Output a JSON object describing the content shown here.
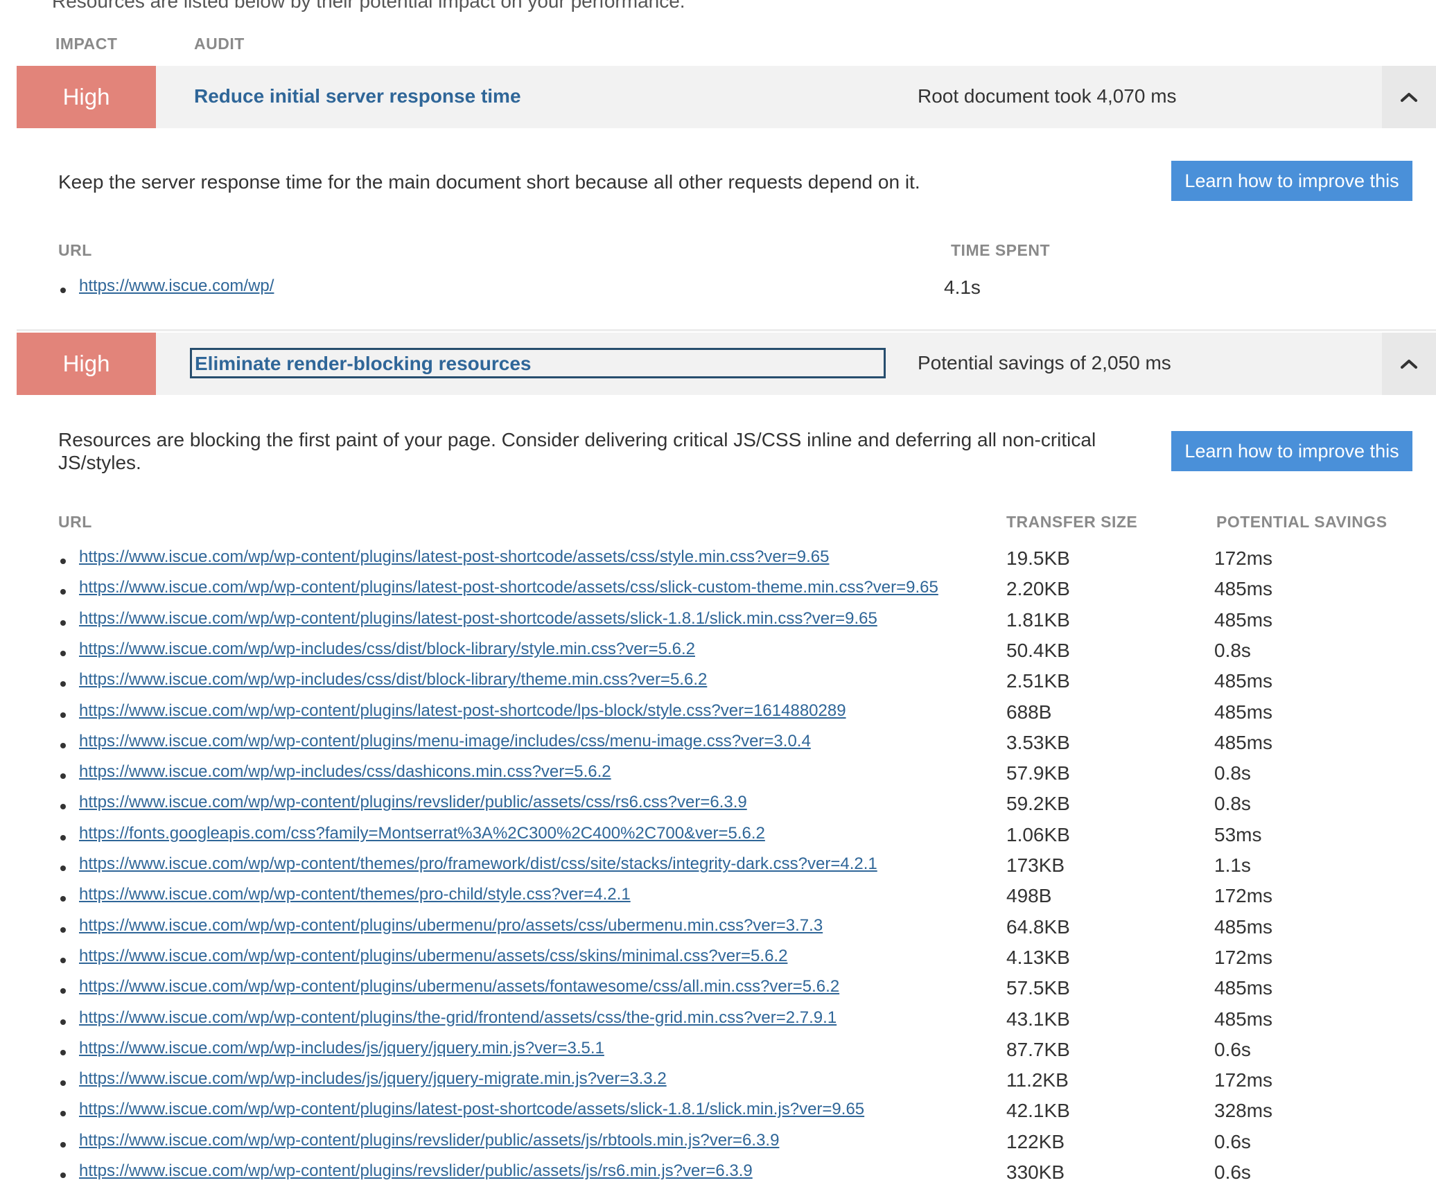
{
  "top_clip": "Resources are listed below by their potential impact on your performance.",
  "header": {
    "impact": "IMPACT",
    "audit": "AUDIT"
  },
  "audit1": {
    "impact": "High",
    "title": "Reduce initial server response time",
    "summary": "Root document took 4,070 ms",
    "description": "Keep the server response time for the main document short because all other requests depend on it.",
    "learn": "Learn how to improve this",
    "col_url": "URL",
    "col_time": "TIME SPENT",
    "rows": [
      {
        "url": "https://www.iscue.com/wp/",
        "time": "4.1s"
      }
    ]
  },
  "audit2": {
    "impact": "High",
    "title": "Eliminate render-blocking resources",
    "summary": "Potential savings of 2,050 ms",
    "description": "Resources are blocking the first paint of your page. Consider delivering critical JS/CSS inline and deferring all non-critical JS/styles.",
    "learn": "Learn how to improve this",
    "col_url": "URL",
    "col_size": "TRANSFER SIZE",
    "col_savings": "POTENTIAL SAVINGS",
    "rows": [
      {
        "url": "https://www.iscue.com/wp/wp-content/plugins/latest-post-shortcode/assets/css/style.min.css?ver=9.65",
        "size": "19.5KB",
        "savings": "172ms"
      },
      {
        "url": "https://www.iscue.com/wp/wp-content/plugins/latest-post-shortcode/assets/css/slick-custom-theme.min.css?ver=9.65",
        "size": "2.20KB",
        "savings": "485ms"
      },
      {
        "url": "https://www.iscue.com/wp/wp-content/plugins/latest-post-shortcode/assets/slick-1.8.1/slick.min.css?ver=9.65",
        "size": "1.81KB",
        "savings": "485ms"
      },
      {
        "url": "https://www.iscue.com/wp/wp-includes/css/dist/block-library/style.min.css?ver=5.6.2",
        "size": "50.4KB",
        "savings": "0.8s"
      },
      {
        "url": "https://www.iscue.com/wp/wp-includes/css/dist/block-library/theme.min.css?ver=5.6.2",
        "size": "2.51KB",
        "savings": "485ms"
      },
      {
        "url": "https://www.iscue.com/wp/wp-content/plugins/latest-post-shortcode/lps-block/style.css?ver=1614880289",
        "size": "688B",
        "savings": "485ms"
      },
      {
        "url": "https://www.iscue.com/wp/wp-content/plugins/menu-image/includes/css/menu-image.css?ver=3.0.4",
        "size": "3.53KB",
        "savings": "485ms"
      },
      {
        "url": "https://www.iscue.com/wp/wp-includes/css/dashicons.min.css?ver=5.6.2",
        "size": "57.9KB",
        "savings": "0.8s"
      },
      {
        "url": "https://www.iscue.com/wp/wp-content/plugins/revslider/public/assets/css/rs6.css?ver=6.3.9",
        "size": "59.2KB",
        "savings": "0.8s"
      },
      {
        "url": "https://fonts.googleapis.com/css?family=Montserrat%3A%2C300%2C400%2C700&ver=5.6.2",
        "size": "1.06KB",
        "savings": "53ms"
      },
      {
        "url": "https://www.iscue.com/wp/wp-content/themes/pro/framework/dist/css/site/stacks/integrity-dark.css?ver=4.2.1",
        "size": "173KB",
        "savings": "1.1s"
      },
      {
        "url": "https://www.iscue.com/wp/wp-content/themes/pro-child/style.css?ver=4.2.1",
        "size": "498B",
        "savings": "172ms"
      },
      {
        "url": "https://www.iscue.com/wp/wp-content/plugins/ubermenu/pro/assets/css/ubermenu.min.css?ver=3.7.3",
        "size": "64.8KB",
        "savings": "485ms"
      },
      {
        "url": "https://www.iscue.com/wp/wp-content/plugins/ubermenu/assets/css/skins/minimal.css?ver=5.6.2",
        "size": "4.13KB",
        "savings": "172ms"
      },
      {
        "url": "https://www.iscue.com/wp/wp-content/plugins/ubermenu/assets/fontawesome/css/all.min.css?ver=5.6.2",
        "size": "57.5KB",
        "savings": "485ms"
      },
      {
        "url": "https://www.iscue.com/wp/wp-content/plugins/the-grid/frontend/assets/css/the-grid.min.css?ver=2.7.9.1",
        "size": "43.1KB",
        "savings": "485ms"
      },
      {
        "url": "https://www.iscue.com/wp/wp-includes/js/jquery/jquery.min.js?ver=3.5.1",
        "size": "87.7KB",
        "savings": "0.6s"
      },
      {
        "url": "https://www.iscue.com/wp/wp-includes/js/jquery/jquery-migrate.min.js?ver=3.3.2",
        "size": "11.2KB",
        "savings": "172ms"
      },
      {
        "url": "https://www.iscue.com/wp/wp-content/plugins/latest-post-shortcode/assets/slick-1.8.1/slick.min.js?ver=9.65",
        "size": "42.1KB",
        "savings": "328ms"
      },
      {
        "url": "https://www.iscue.com/wp/wp-content/plugins/revslider/public/assets/js/rbtools.min.js?ver=6.3.9",
        "size": "122KB",
        "savings": "0.6s"
      },
      {
        "url": "https://www.iscue.com/wp/wp-content/plugins/revslider/public/assets/js/rs6.min.js?ver=6.3.9",
        "size": "330KB",
        "savings": "0.6s"
      }
    ]
  },
  "colors": {
    "impact_high": "#e2847a",
    "title_link": "#2f6698",
    "button": "#4a90d9",
    "bar": "#f2f2f2"
  },
  "icons": {
    "toggle": "chevron-up-icon"
  }
}
